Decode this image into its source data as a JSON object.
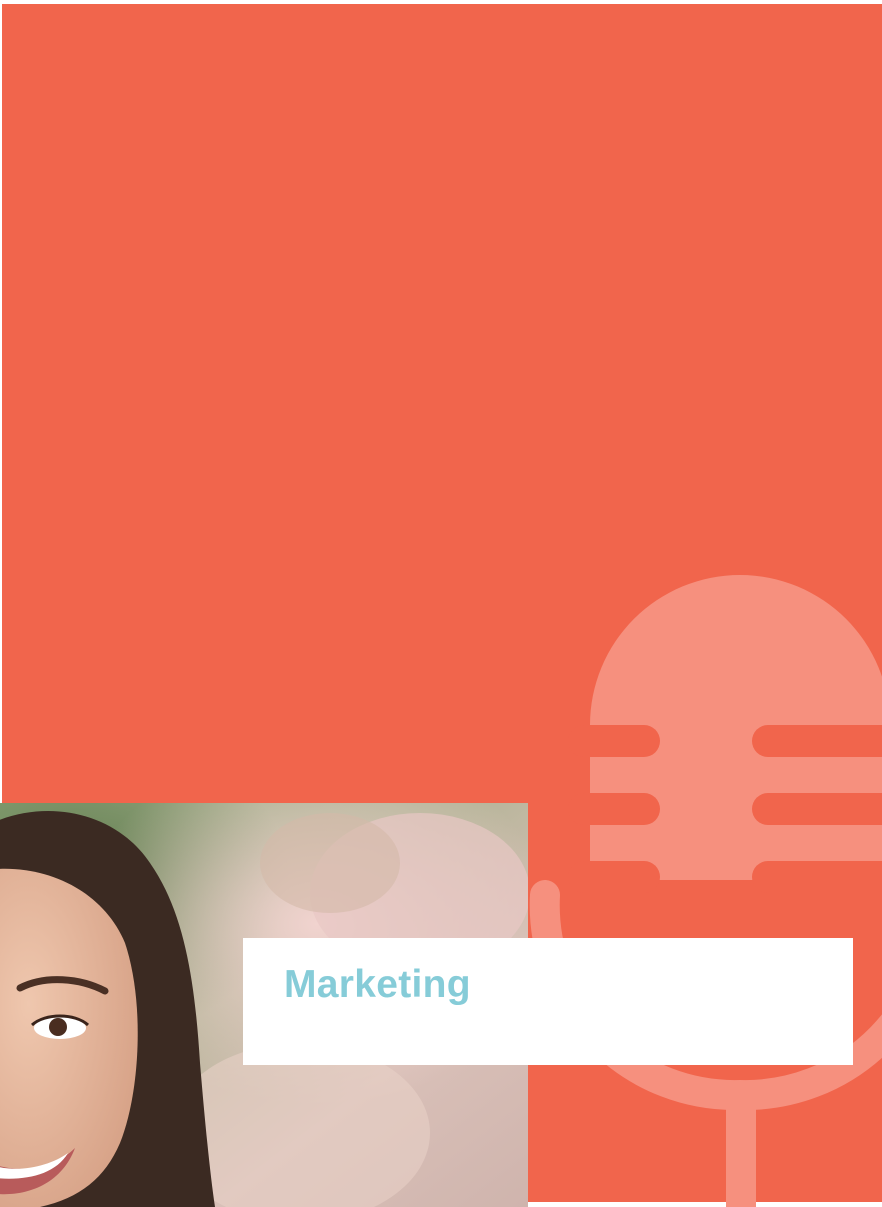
{
  "cover": {
    "title": "Marketing",
    "colors": {
      "panel": "#f1654c",
      "microphone": "#f6907e",
      "title_text": "#86ccd8",
      "title_card": "#ffffff"
    },
    "icon": "microphone-icon",
    "photo": "smiling-woman-photo"
  }
}
